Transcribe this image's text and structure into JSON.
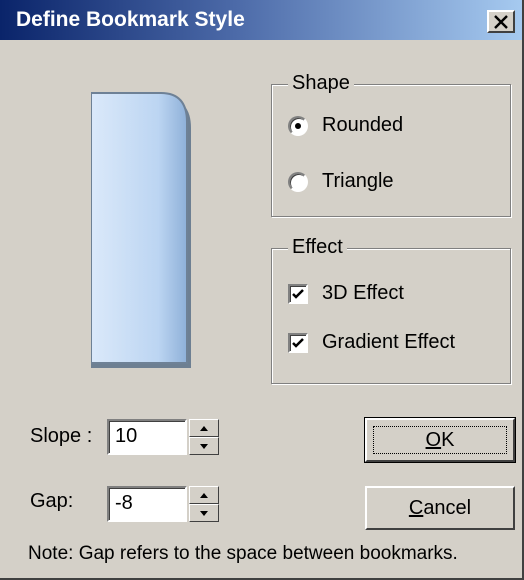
{
  "window": {
    "title": "Define Bookmark Style",
    "close_symbol": "X"
  },
  "preview": {
    "shape": "rounded",
    "fill_top": "#d6e6f8",
    "fill_bottom": "#a9c8ec",
    "border": "#5f7286"
  },
  "shape_group": {
    "legend": "Shape",
    "options": [
      {
        "label": "Rounded",
        "selected": true
      },
      {
        "label": "Triangle",
        "selected": false
      }
    ]
  },
  "effect_group": {
    "legend": "Effect",
    "options": [
      {
        "label": "3D Effect",
        "checked": true
      },
      {
        "label": "Gradient Effect",
        "checked": true
      }
    ]
  },
  "fields": {
    "slope": {
      "label": "Slope :",
      "value": "10"
    },
    "gap": {
      "label": "Gap:",
      "value": "-8"
    }
  },
  "buttons": {
    "ok": {
      "label_underlined": "O",
      "label_rest": "K"
    },
    "cancel": {
      "label_underlined": "C",
      "label_rest": "ancel"
    }
  },
  "note": "Note: Gap refers to the space between bookmarks.",
  "colors": {
    "titlebar_start": "#0a246a",
    "titlebar_end": "#a6caf0",
    "dialog_bg": "#d4d0c8"
  }
}
